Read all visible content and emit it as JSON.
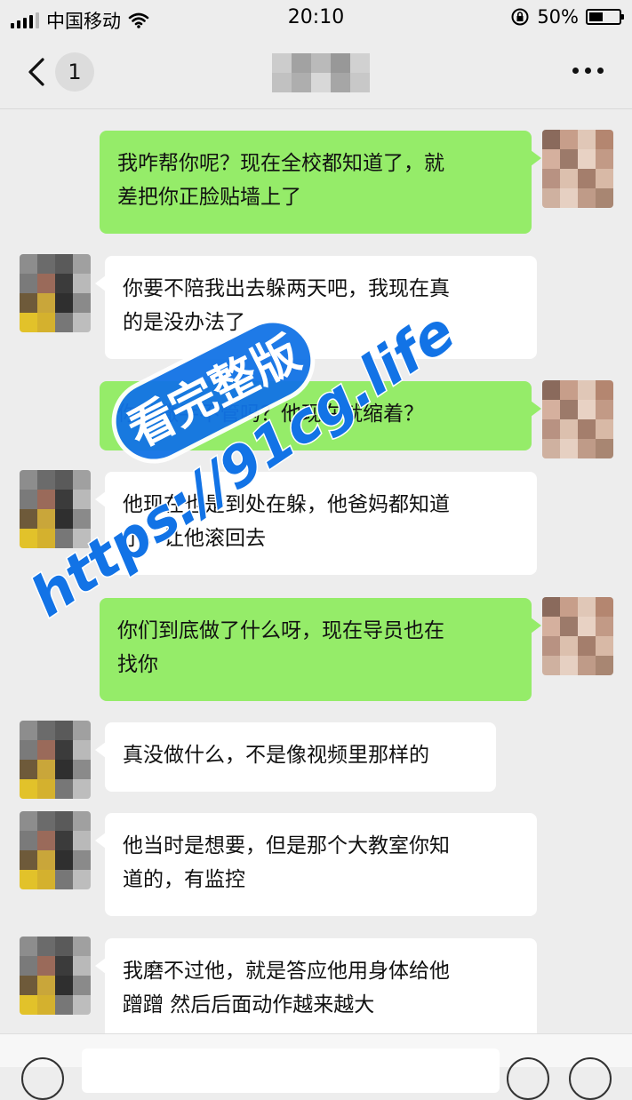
{
  "status": {
    "carrier": "中国移动",
    "time": "20:10",
    "battery": "50%",
    "battery_level": 0.5
  },
  "nav": {
    "badge_count": "1"
  },
  "messages": [
    {
      "dir": "out",
      "lines": [
        "我咋帮你呢？现在全校都知道了，就",
        "差把你正脸贴墙上了"
      ]
    },
    {
      "dir": "in",
      "lines": [
        "你要不陪我出去躲两天吧，我现在真",
        "的是没办法了"
      ]
    },
    {
      "dir": "out",
      "lines": [
        "你就撒手不管吗？他现在就缩着？"
      ]
    },
    {
      "dir": "in",
      "lines": [
        "他现在也是到处在躲，他爸妈都知道",
        "了，让他滚回去"
      ]
    },
    {
      "dir": "out",
      "lines": [
        "你们到底做了什么呀，现在导员也在",
        "找你"
      ]
    },
    {
      "dir": "in",
      "lines": [
        "真没做什么，不是像视频里那样的"
      ]
    },
    {
      "dir": "in",
      "lines": [
        "他当时是想要，但是那个大教室你知",
        "道的，有监控"
      ]
    },
    {
      "dir": "in",
      "lines": [
        "我磨不过他，就是答应他用身体给他",
        "蹭蹭 然后后面动作越来越大"
      ]
    }
  ],
  "watermark": {
    "line1": "看完整版",
    "line2": "https://91cg.life"
  },
  "icons": [
    "signal-icon",
    "wifi-icon",
    "rotation-lock-icon",
    "battery-icon",
    "back-chevron-icon",
    "more-icon",
    "voice-icon",
    "emoji-icon"
  ],
  "colors": {
    "outgoing": "#95ec69",
    "incoming": "#ffffff",
    "background": "#ededed",
    "watermark": "#1273e6"
  }
}
